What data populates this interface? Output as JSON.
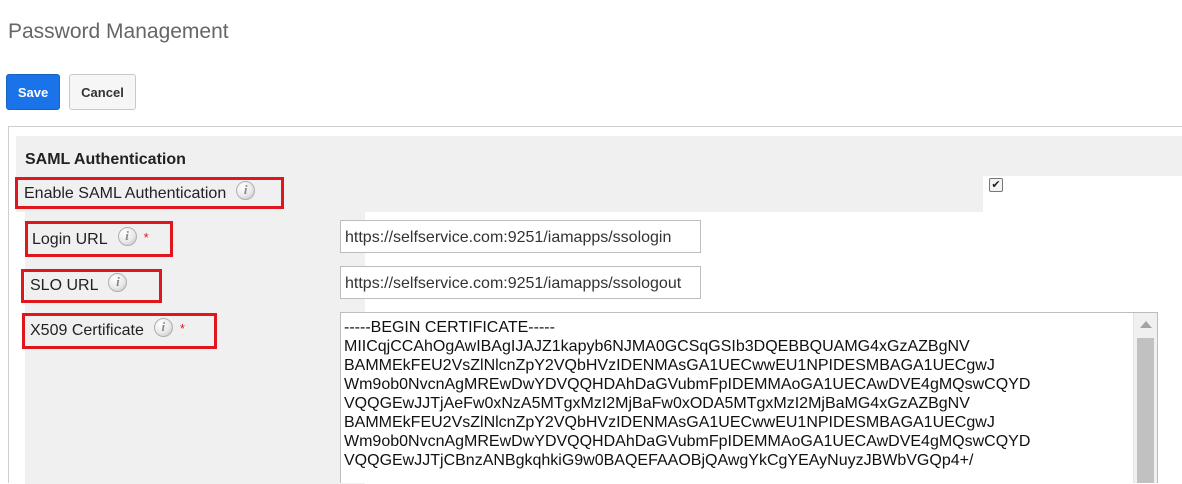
{
  "page": {
    "title": "Password Management"
  },
  "toolbar": {
    "save_label": "Save",
    "cancel_label": "Cancel"
  },
  "saml": {
    "section_title": "SAML Authentication",
    "enable_label": "Enable SAML Authentication",
    "enable_checked": true,
    "checkbox_glyph": "✔",
    "login_url_label": "Login URL",
    "login_url_value": "https://selfservice.com:9251/iamapps/ssologin",
    "slo_url_label": "SLO URL",
    "slo_url_value": "https://selfservice.com:9251/iamapps/ssologout",
    "cert_label": "X509 Certificate",
    "required_mark": "*",
    "info_glyph": "i",
    "certificate_lines": [
      "-----BEGIN CERTIFICATE-----",
      "MIICqjCCAhOgAwIBAgIJAJZ1kapyb6NJMA0GCSqGSIb3DQEBBQUAMG4xGzAZBgNV",
      "BAMMEkFEU2VsZlNlcnZpY2VQbHVzIDENMAsGA1UECwwEU1NPIDESMBAGA1UECgwJ",
      "Wm9ob0NvcnAgMREwDwYDVQQHDAhDaGVubmFpIDEMMAoGA1UECAwDVE4gMQswCQYD",
      "VQQGEwJJTjAeFw0xNzA5MTgxMzI2MjBaFw0xODA5MTgxMzI2MjBaMG4xGzAZBgNV",
      "BAMMEkFEU2VsZlNlcnZpY2VQbHVzIDENMAsGA1UECwwEU1NPIDESMBAGA1UECgwJ",
      "Wm9ob0NvcnAgMREwDwYDVQQHDAhDaGVubmFpIDEMMAoGA1UECAwDVE4gMQswCQYD",
      "VQQGEwJJTjCBnzANBgkqhkiG9w0BAQEFAAOBjQAwgYkCgYEAyNuyzJBWbVGQp4+/"
    ]
  },
  "colors": {
    "accent": "#1a73e8",
    "highlight": "#e0161e",
    "section_bg": "#f0f0f0"
  }
}
